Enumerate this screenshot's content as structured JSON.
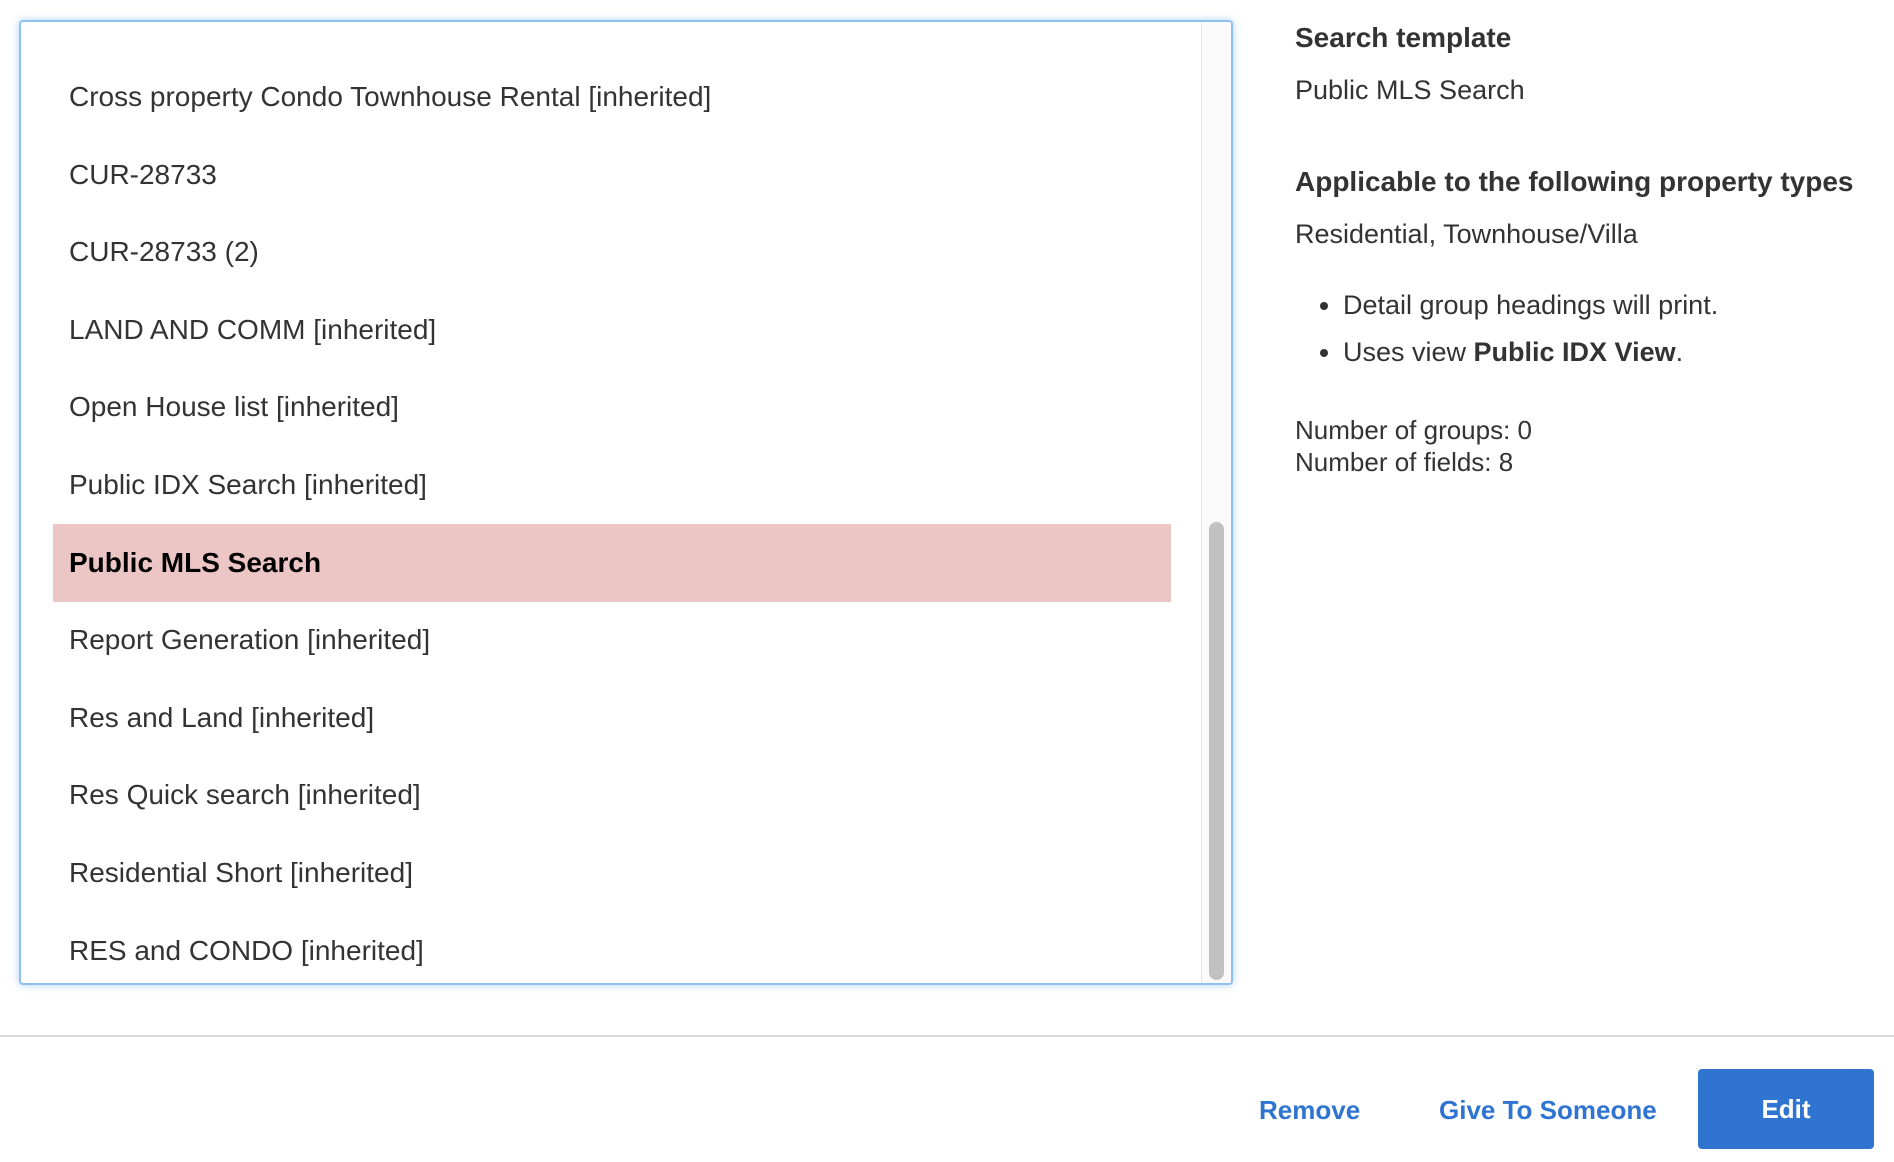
{
  "list": {
    "items": [
      {
        "label": "Cross property Condo Townhouse Rental [inherited]",
        "selected": false
      },
      {
        "label": "CUR-28733",
        "selected": false
      },
      {
        "label": "CUR-28733 (2)",
        "selected": false
      },
      {
        "label": "LAND AND COMM [inherited]",
        "selected": false
      },
      {
        "label": "Open House list [inherited]",
        "selected": false
      },
      {
        "label": "Public IDX Search [inherited]",
        "selected": false
      },
      {
        "label": "Public MLS Search",
        "selected": true
      },
      {
        "label": "Report Generation [inherited]",
        "selected": false
      },
      {
        "label": "Res and Land [inherited]",
        "selected": false
      },
      {
        "label": "Res Quick search [inherited]",
        "selected": false
      },
      {
        "label": "Residential Short [inherited]",
        "selected": false
      },
      {
        "label": "RES and CONDO [inherited]",
        "selected": false
      }
    ],
    "selected_color": "#ecc5c5"
  },
  "detail": {
    "search_template_heading": "Search template",
    "search_template_value": "Public MLS Search",
    "property_types_heading": "Applicable to the following property types",
    "property_types_value": "Residential, Townhouse/Villa",
    "bullets": {
      "headings": "Detail group headings will print.",
      "view_prefix": "Uses view ",
      "view_name": "Public IDX View",
      "view_suffix": "."
    },
    "groups_count": "Number of groups: 0",
    "fields_count": "Number of fields: 8"
  },
  "footer": {
    "remove_label": "Remove",
    "give_label": "Give To Someone",
    "edit_label": "Edit",
    "accent_color": "#2f74d0"
  }
}
